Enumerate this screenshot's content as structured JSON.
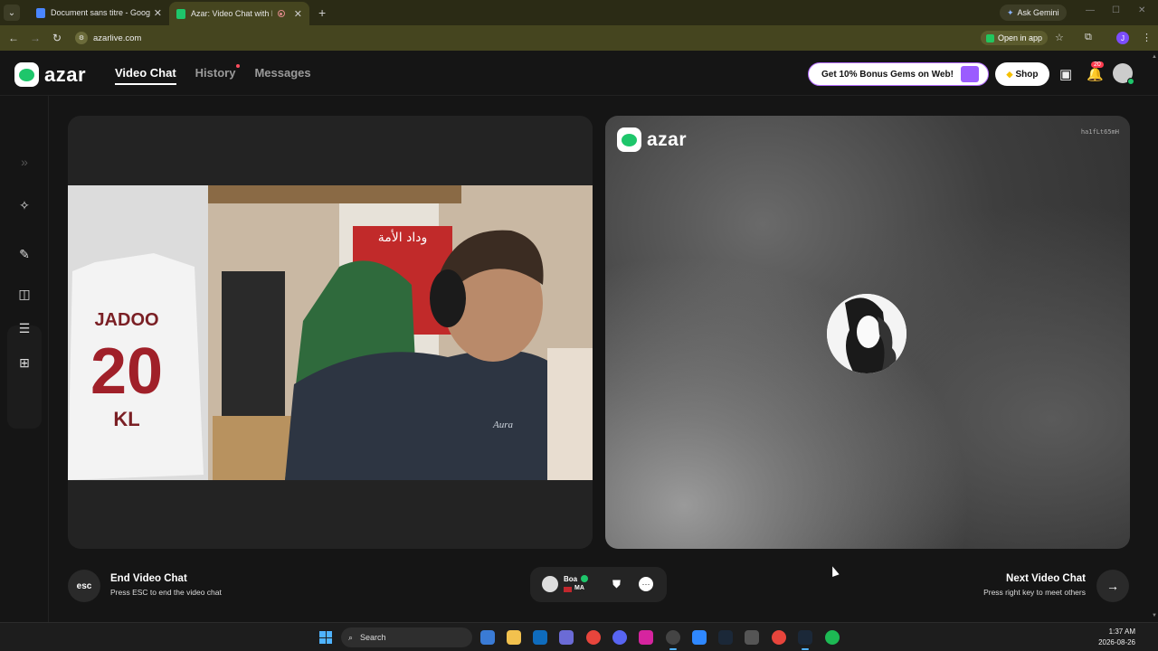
{
  "browser": {
    "tabs": [
      {
        "title": "Document sans titre - Google D",
        "favicon_color": "#4a86ff",
        "active": false
      },
      {
        "title": "Azar: Video Chat with New",
        "favicon_color": "#1ec66b",
        "active": true,
        "recording": true
      }
    ],
    "ask_gemini": "Ask Gemini",
    "url": "azarlive.com",
    "open_in_app": "Open in app",
    "profile_initial": "J"
  },
  "app": {
    "logo_text": "azar",
    "nav": [
      {
        "label": "Video Chat",
        "active": true
      },
      {
        "label": "History",
        "active": false,
        "notification_dot": true
      },
      {
        "label": "Messages",
        "active": false
      }
    ],
    "promo_label": "Get 10% Bonus Gems on Web!",
    "shop_label": "Shop",
    "notification_count": "20",
    "accent_color": "#1ec66b"
  },
  "sidebar": {
    "icons": [
      "expand-icon",
      "magic-wand-icon",
      "edit-icon",
      "layout-side-by-side-icon",
      "layout-stacked-icon",
      "layout-grid-icon"
    ]
  },
  "remote": {
    "logo_text": "azar",
    "watermark": "ha1fLt65mH"
  },
  "controls": {
    "esc_key": "esc",
    "end_title": "End Video Chat",
    "end_sub": "Press ESC to end the video chat",
    "partner_name": "Boa",
    "partner_country": "MA",
    "next_title": "Next Video Chat",
    "next_sub": "Press right key to meet others"
  },
  "taskbar": {
    "search_label": "Search",
    "time": "1:37 AM",
    "date": "2026-08-26"
  },
  "camera_scene": {
    "jersey_name": "JADOO",
    "jersey_number": "20",
    "jersey_text": "KL",
    "banner_text": "وداد الأمة",
    "shirt_text": "Aura"
  }
}
